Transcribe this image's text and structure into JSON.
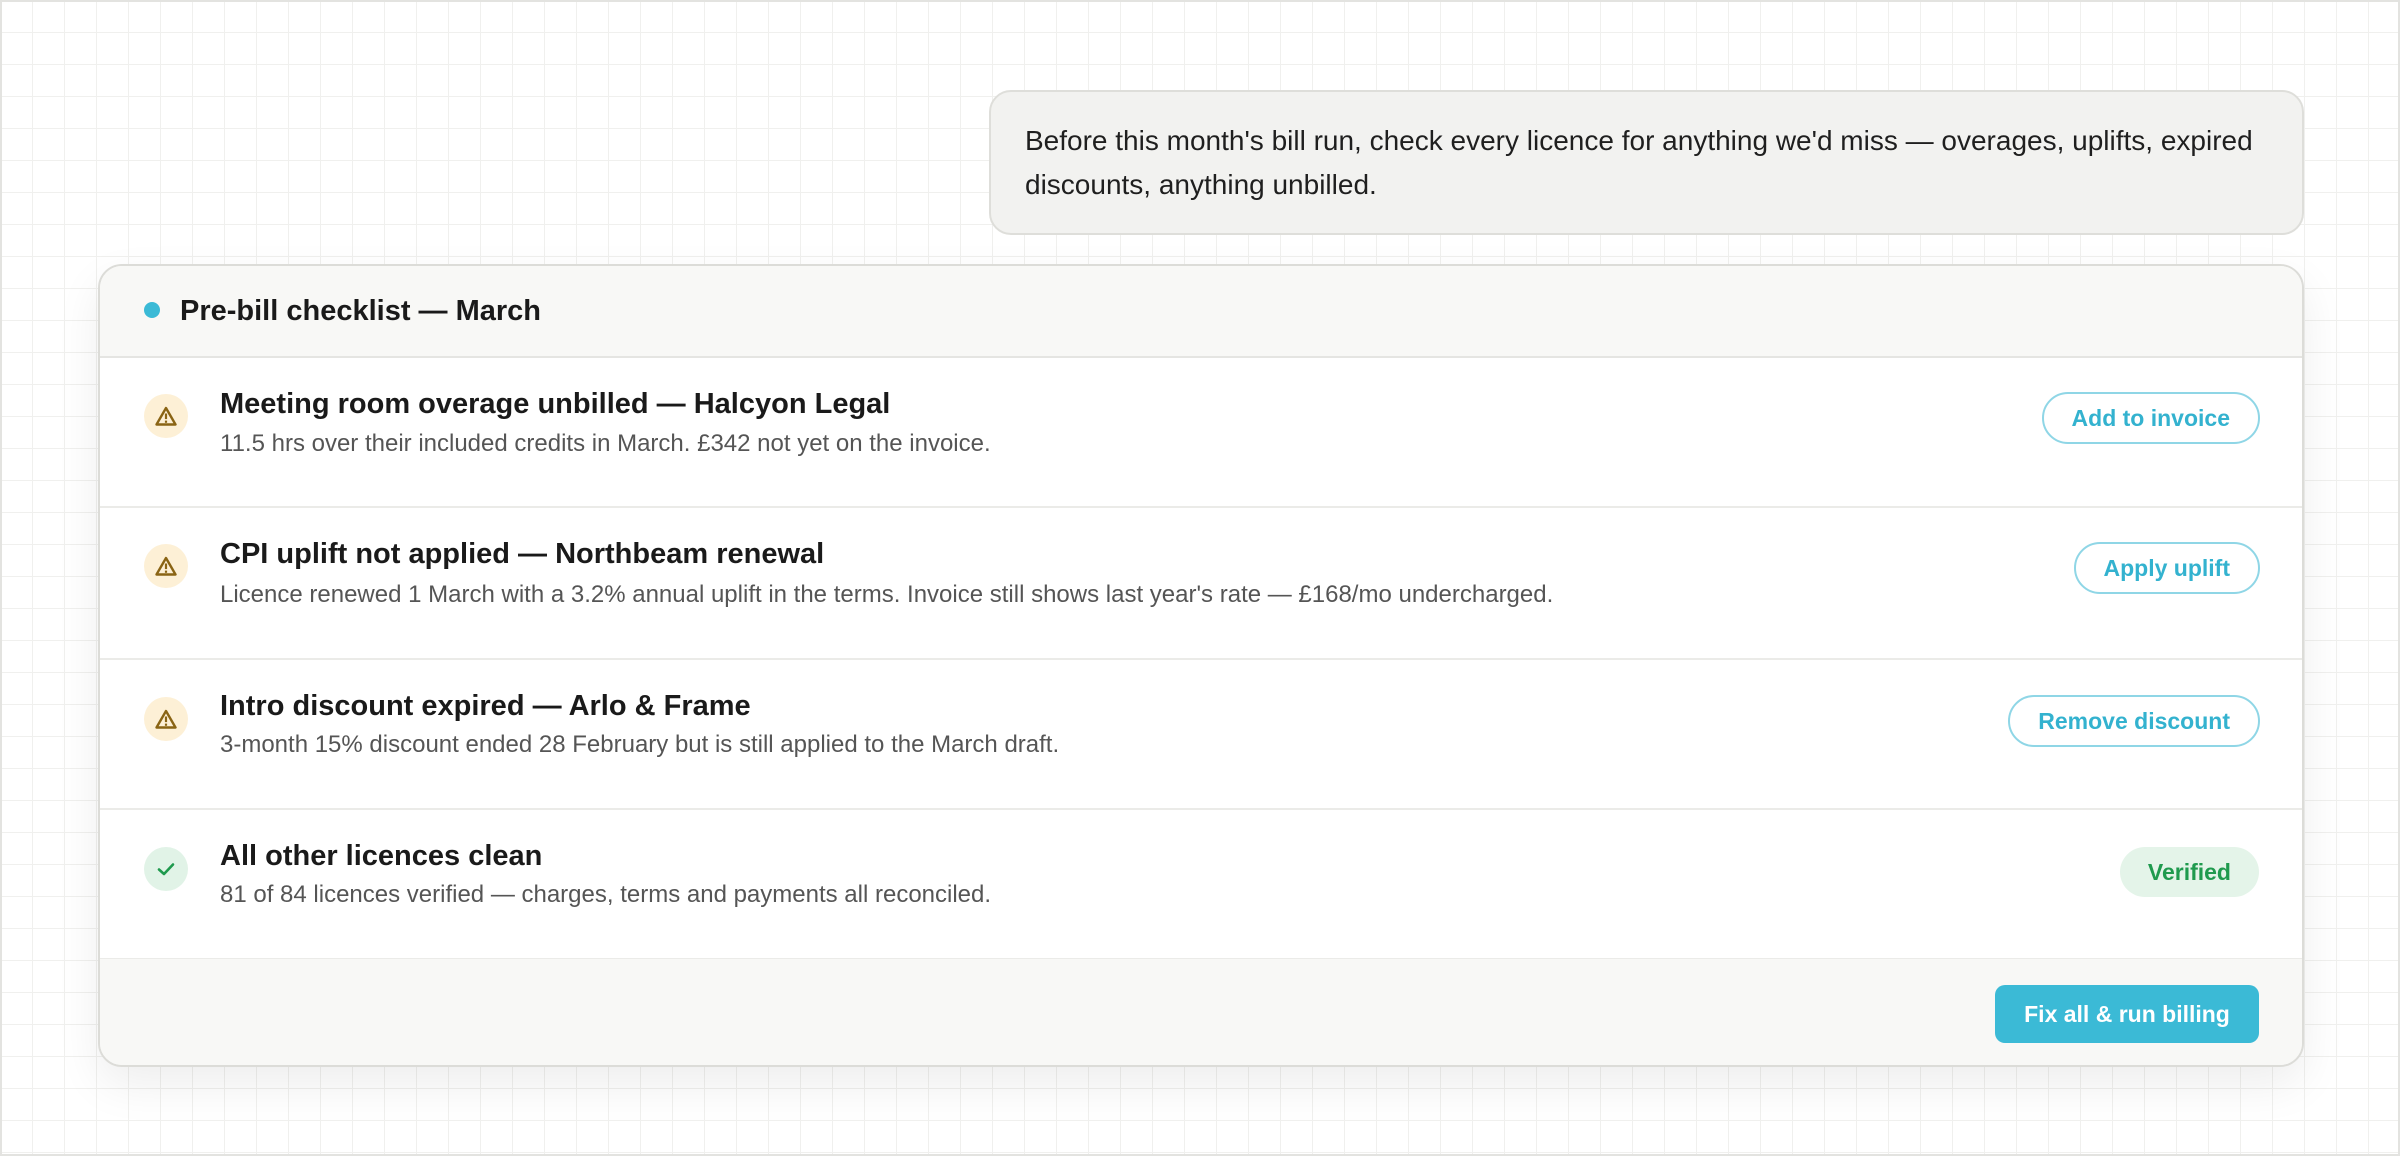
{
  "chat": {
    "user_message": "Before this month's bill run, check every licence for anything we'd miss — overages, uplifts, expired discounts, anything unbilled."
  },
  "checklist": {
    "title": "Pre-bill checklist — March",
    "accent_color": "#3bbad6",
    "items": [
      {
        "status": "warning",
        "icon": "warning-triangle-icon",
        "title": "Meeting room overage unbilled — Halcyon Legal",
        "description": "11.5 hrs over their included credits in March. £342 not yet on the invoice.",
        "action_label": "Add to invoice"
      },
      {
        "status": "warning",
        "icon": "warning-triangle-icon",
        "title": "CPI uplift not applied — Northbeam renewal",
        "description": "Licence renewed 1 March with a 3.2% annual uplift in the terms. Invoice still shows last year's rate — £168/mo undercharged.",
        "action_label": "Apply uplift"
      },
      {
        "status": "warning",
        "icon": "warning-triangle-icon",
        "title": "Intro discount expired — Arlo & Frame",
        "description": "3-month 15% discount ended 28 February but is still applied to the March draft.",
        "action_label": "Remove discount"
      },
      {
        "status": "ok",
        "icon": "check-icon",
        "title": "All other licences clean",
        "description": "81 of 84 licences verified — charges, terms and payments all reconciled.",
        "badge_label": "Verified"
      }
    ],
    "footer": {
      "primary_label": "Fix all & run billing"
    }
  }
}
